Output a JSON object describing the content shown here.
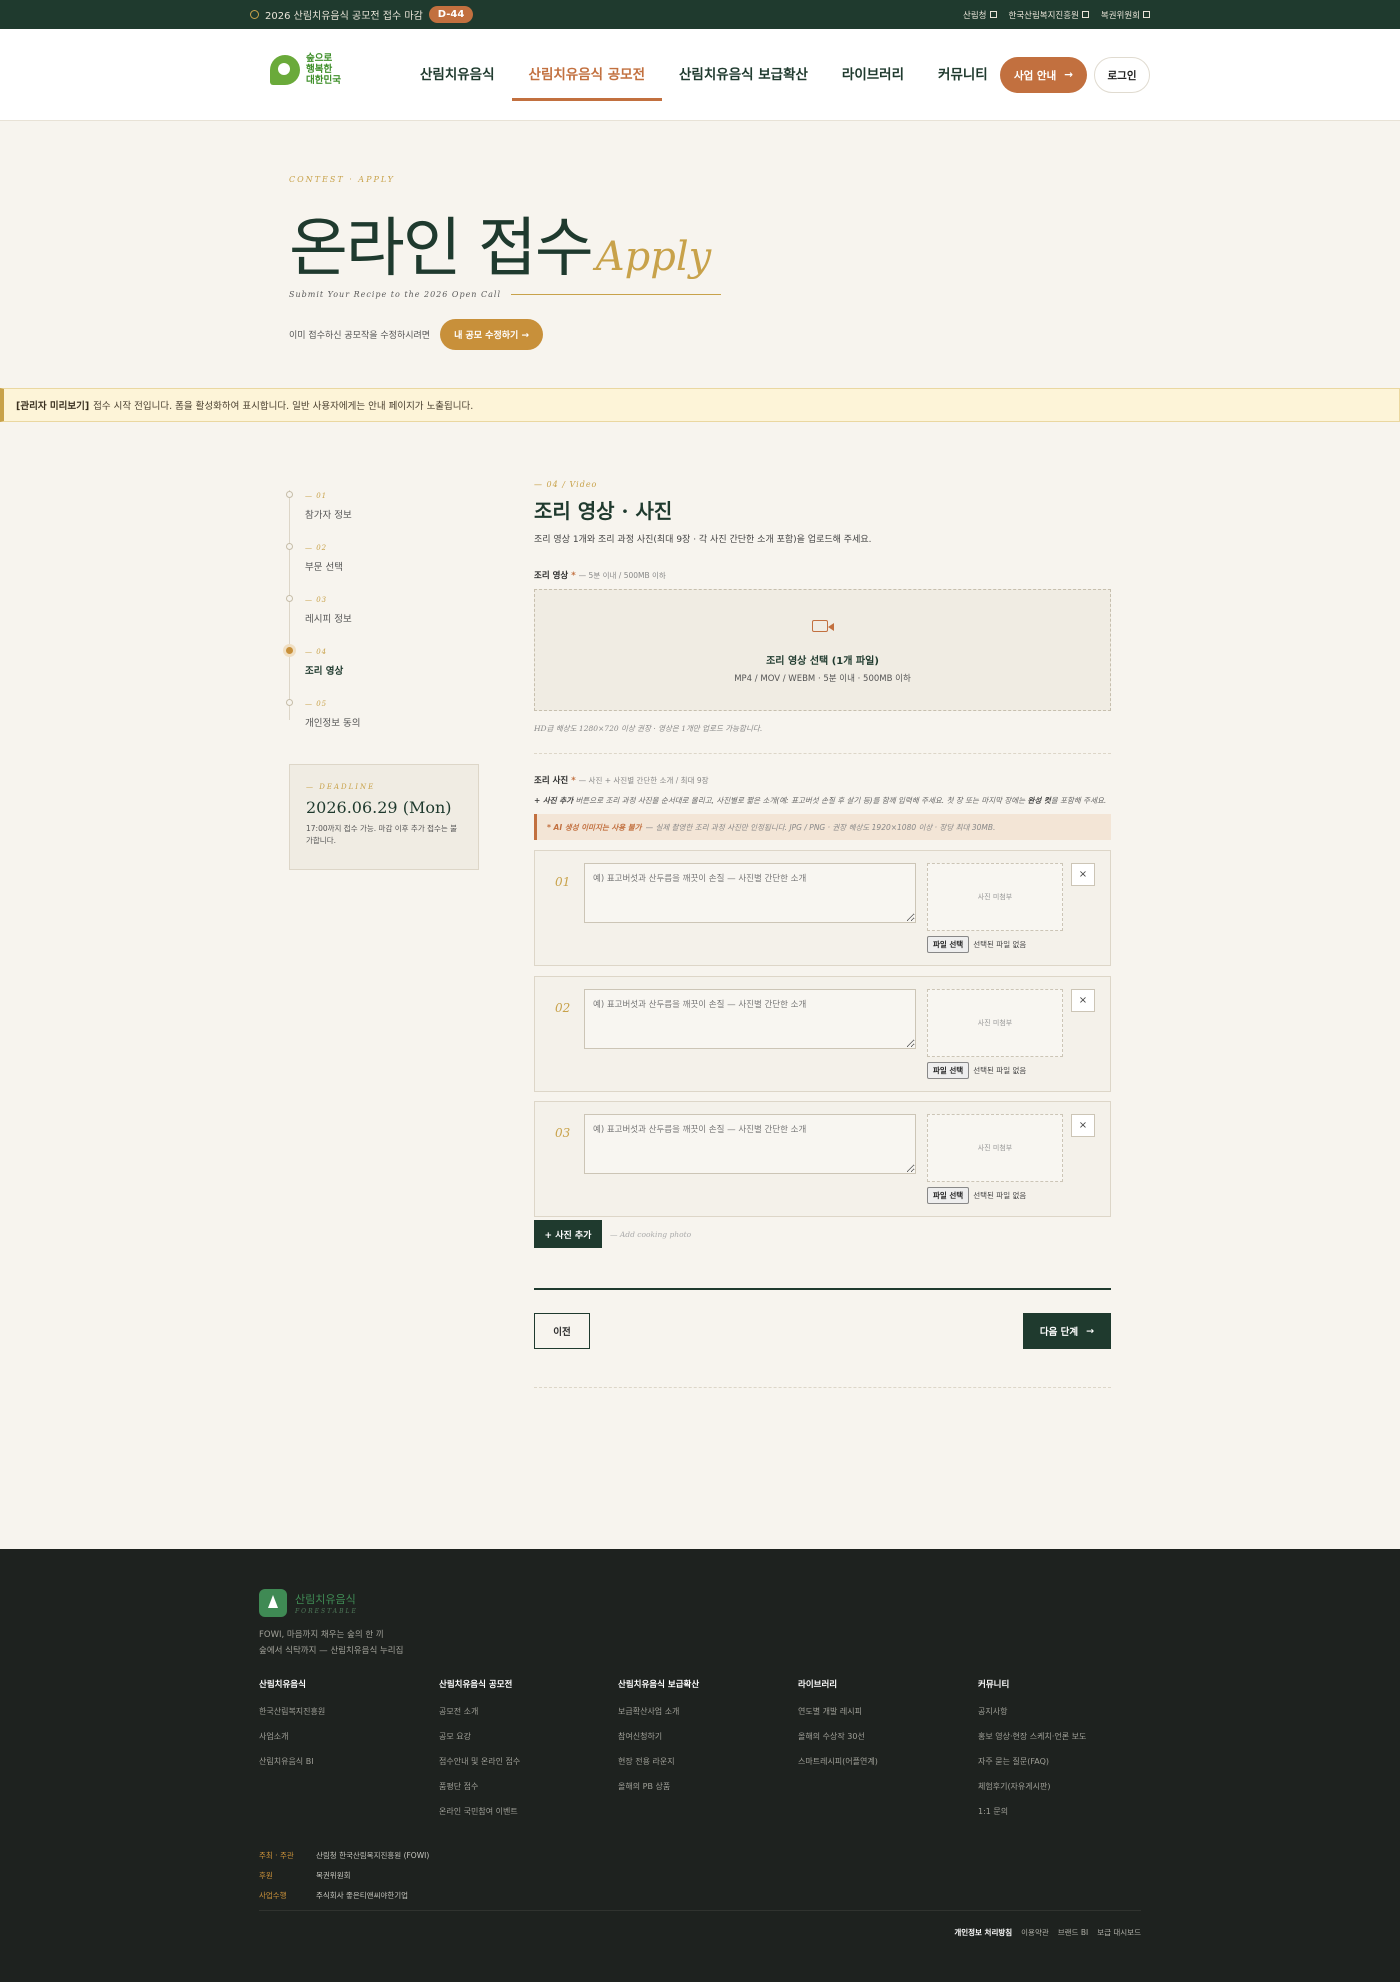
{
  "topbar": {
    "notice": "2026 산림치유음식 공모전 접수 마감",
    "dday": "D-44",
    "links": [
      "산림청",
      "한국산림복지진흥원",
      "복권위원회"
    ]
  },
  "header": {
    "logo_text": [
      "숲으로",
      "행복한",
      "대한민국"
    ],
    "nav": [
      "산림치유음식",
      "산림치유음식 공모전",
      "산림치유음식 보급확산",
      "라이브러리",
      "커뮤니티"
    ],
    "active_nav": "산림치유음식 공모전",
    "guide_label": "사업 안내",
    "login_label": "로그인"
  },
  "hero": {
    "kicker": "CONTEST · APPLY",
    "title": "온라인 접수",
    "title_en": "Apply",
    "subtitle": "Submit Your Recipe to the 2026 Open Call",
    "edit_text": "이미 접수하신 공모작을 수정하시려면",
    "edit_button": "내 공모 수정하기 →"
  },
  "admin_notice": {
    "tag": "[관리자 미리보기]",
    "text": "접수 시작 전입니다. 폼을 활성화하여 표시합니다. 일반 사용자에게는 안내 페이지가 노출됩니다."
  },
  "steps": [
    {
      "num": "— 01",
      "label": "참가자 정보"
    },
    {
      "num": "— 02",
      "label": "부문 선택"
    },
    {
      "num": "— 03",
      "label": "레시피 정보"
    },
    {
      "num": "— 04",
      "label": "조리 영상"
    },
    {
      "num": "— 05",
      "label": "개인정보 동의"
    }
  ],
  "current_step": 4,
  "deadline": {
    "kicker": "— DEADLINE",
    "date": "2026.06.29 (Mon)",
    "note": "17:00까지 접수 가능. 마감 이후 추가 접수는 불가합니다."
  },
  "form": {
    "kicker": "— 04 / Video",
    "title": "조리 영상 · 사진",
    "desc": "조리 영상 1개와 조리 과정 사진(최대 9장 · 각 사진 간단한 소개 포함)을 업로드해 주세요.",
    "video_label": "조리 영상",
    "video_req": "*",
    "video_hint": "— 5분 이내 / 500MB 이하",
    "video_title": "조리 영상 선택 (1개 파일)",
    "video_formats": "MP4 / MOV / WEBM · 5분 이내 · 500MB 이하",
    "video_note": "HD급 해상도 1280×720 이상 권장 · 영상은 1개만 업로드 가능합니다.",
    "photo_label": "조리 사진",
    "photo_req": "*",
    "photo_hint": "— 사진 + 사진별 간단한 소개 / 최대 9장",
    "photo_add_tag": "+ 사진 추가",
    "photo_add_text": "버튼으로 조리 과정 사진을 순서대로 올리고, 사진별로 짧은 소개(예: 표고버섯 손질 후 살기 등)를 함께 입력해 주세요. 첫 장 또는 마지막 장에는",
    "photo_add_bold": "완성 컷",
    "photo_add_end": "을 포함해 주세요.",
    "ai_tag": "* AI 생성 이미지는 사용 불가",
    "ai_text": "— 실제 촬영한 조리 과정 사진만 인정됩니다. JPG / PNG · 권장 해상도 1920×1080 이상 · 장당 최대 30MB.",
    "photos": [
      {
        "no": "01",
        "placeholder": "예) 표고버섯과 산두릅을 깨끗이 손질 — 사진별 간단한 소개",
        "thumb": "사진 미첨부",
        "file_btn": "파일 선택",
        "file_status": "선택된 파일 없음",
        "remove": "×"
      },
      {
        "no": "02",
        "placeholder": "예) 표고버섯과 산두릅을 깨끗이 손질 — 사진별 간단한 소개",
        "thumb": "사진 미첨부",
        "file_btn": "파일 선택",
        "file_status": "선택된 파일 없음",
        "remove": "×"
      },
      {
        "no": "03",
        "placeholder": "예) 표고버섯과 산두릅을 깨끗이 손질 — 사진별 간단한 소개",
        "thumb": "사진 미첨부",
        "file_btn": "파일 선택",
        "file_status": "선택된 파일 없음",
        "remove": "×"
      }
    ],
    "add_photo": "+ 사진 추가",
    "add_photo_en": "— Add cooking photo",
    "prev": "이전",
    "next": "다음 단계"
  },
  "footer": {
    "brand": "산림치유음식",
    "brand_en": "FORESTABLE",
    "tagline": [
      "FOWI, 마음까지 채우는 숲의 한 끼",
      "숲에서 식탁까지 — 산림치유음식 누리집"
    ],
    "columns": [
      {
        "title": "산림치유음식",
        "items": [
          "한국산림복지진흥원",
          "사업소개",
          "산림치유음식 BI"
        ]
      },
      {
        "title": "산림치유음식 공모전",
        "items": [
          "공모전 소개",
          "공모 요강",
          "접수안내 및 온라인 접수",
          "품평단 접수",
          "온라인 국민참여 이벤트"
        ]
      },
      {
        "title": "산림치유음식 보급확산",
        "items": [
          "보급확산사업 소개",
          "참여신청하기",
          "현장 전용 라운지",
          "올해의 PB 상품"
        ]
      },
      {
        "title": "라이브러리",
        "items": [
          "연도별 개발 레시피",
          "올해의 수상작 30선",
          "스마트레시피(어플연계)"
        ]
      },
      {
        "title": "커뮤니티",
        "items": [
          "공지사항",
          "홍보 영상·현장 스케치·언론 보도",
          "자주 묻는 질문(FAQ)",
          "체험후기(자유게시판)",
          "1:1 문의"
        ]
      }
    ],
    "credits": [
      {
        "k": "주최 · 주관",
        "v": "산림청   한국산림복지진흥원 (FOWI)"
      },
      {
        "k": "후원",
        "v": "복권위원회"
      },
      {
        "k": "사업수행",
        "v": "주식회사 좋은티앤씨야한기업"
      }
    ],
    "links": [
      "개인정보 처리방침",
      "이용약관",
      "브랜드 BI",
      "보급 대시보드"
    ]
  }
}
